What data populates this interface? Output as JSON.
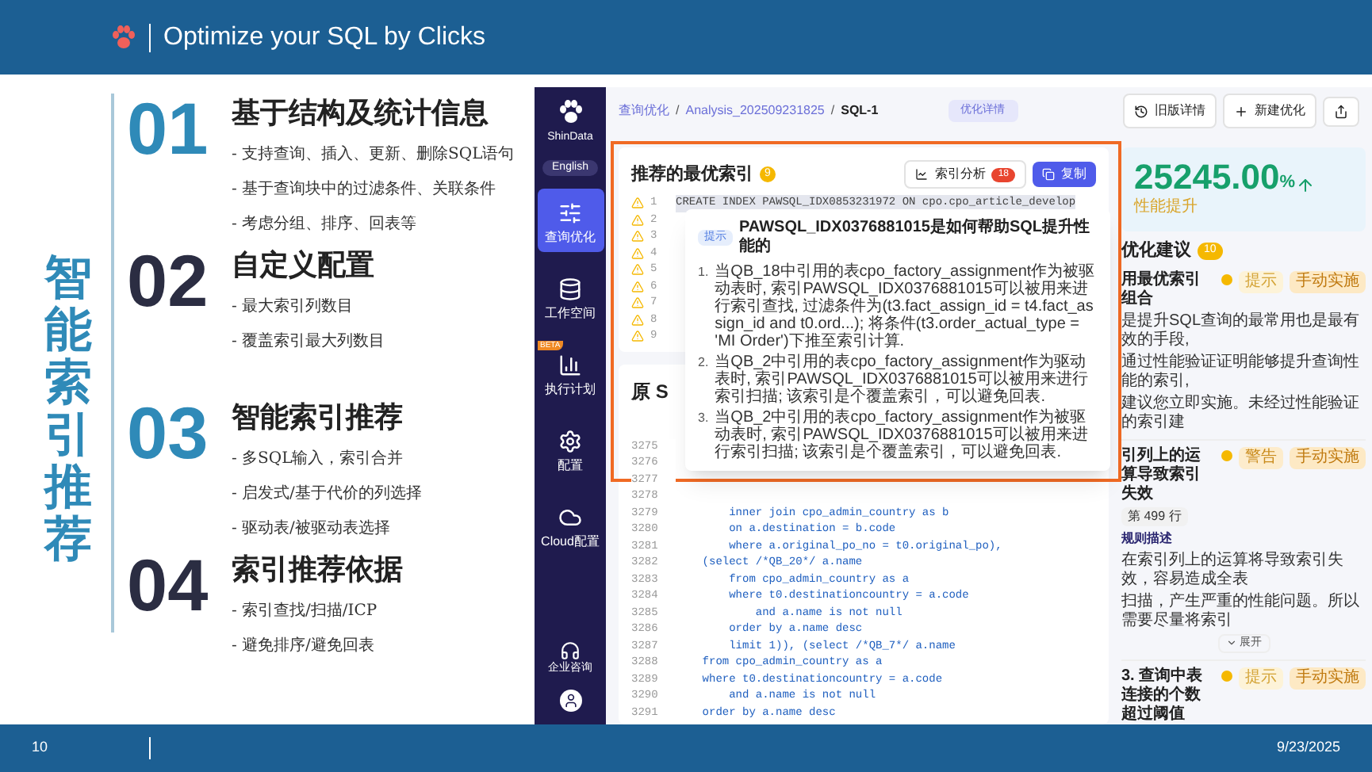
{
  "header": {
    "title": "Optimize your SQL by Clicks"
  },
  "side_title": "智能索引推荐",
  "sections": [
    {
      "number": "01",
      "color": "#2f8ab8",
      "heading": "基于结构及统计信息",
      "bullets": [
        "- 支持查询、插入、更新、删除SQL语句",
        "- 基于查询块中的过滤条件、关联条件",
        "- 考虑分组、排序、回表等"
      ]
    },
    {
      "number": "02",
      "color": "#2b2d42",
      "heading": "自定义配置",
      "bullets": [
        "- 最大索引列数目",
        "- 覆盖索引最大列数目"
      ]
    },
    {
      "number": "03",
      "color": "#2f8ab8",
      "heading": "智能索引推荐",
      "bullets": [
        "- 多SQL输入，索引合并",
        "- 启发式/基于代价的列选择",
        "- 驱动表/被驱动表选择"
      ]
    },
    {
      "number": "04",
      "color": "#2b2d42",
      "heading": "索引推荐依据",
      "bullets": [
        "- 索引查找/扫描/ICP",
        "- 避免排序/避免回表"
      ]
    }
  ],
  "app": {
    "sidebar": {
      "brand": "ShinData",
      "language": "English",
      "items": [
        {
          "kind": "tune",
          "label": "查询优化",
          "selected": true
        },
        {
          "kind": "database",
          "label": "工作空间",
          "selected": false
        },
        {
          "kind": "chart",
          "label": "执行计划",
          "selected": false,
          "badge": "BETA"
        },
        {
          "kind": "gear",
          "label": "配置",
          "selected": false
        },
        {
          "kind": "cloud",
          "label": "Cloud配置",
          "selected": false
        }
      ],
      "support": "企业咨询"
    },
    "breadcrumb": {
      "separator": "/",
      "items": [
        "查询优化",
        "Analysis_202509231825",
        "SQL-1"
      ]
    },
    "detail_tab": "优化详情",
    "actions": [
      {
        "kind": "history",
        "label": "旧版详情"
      },
      {
        "kind": "plus",
        "label": "新建优化"
      },
      {
        "kind": "share"
      }
    ],
    "index_card": {
      "title": "推荐的最优索引",
      "count": "9",
      "buttons": [
        {
          "kind": "analysis",
          "label": "索引分析",
          "badge": "18"
        },
        {
          "kind": "copy",
          "label": "复制"
        }
      ],
      "lines": [
        {
          "number": "1",
          "code": "CREATE INDEX PAWSQL_IDX0853231972 ON cpo.cpo_article_develop"
        },
        {
          "number": "2"
        },
        {
          "number": "3"
        },
        {
          "number": "4"
        },
        {
          "number": "5"
        },
        {
          "number": "6"
        },
        {
          "number": "7"
        },
        {
          "number": "8"
        },
        {
          "number": "9"
        }
      ]
    },
    "tooltip": {
      "tag": "提示",
      "title": "PAWSQL_IDX0376881015是如何帮助SQL提升性能的",
      "items": [
        {
          "number": "1.",
          "text": "当QB_18中引用的表cpo_factory_assignment作为被驱动表时, 索引PAWSQL_IDX0376881015可以被用来进行索引查找, 过滤条件为(t3.fact_assign_id = t4.fact_assign_id and t0.ord...); 将条件(t3.order_actual_type = 'MI Order')下推至索引计算."
        },
        {
          "number": "2.",
          "text": "当QB_2中引用的表cpo_factory_assignment作为驱动表时, 索引PAWSQL_IDX0376881015可以被用来进行索引扫描; 该索引是个覆盖索引，可以避免回表."
        },
        {
          "number": "3.",
          "text": "当QB_2中引用的表cpo_factory_assignment作为被驱动表时, 索引PAWSQL_IDX0376881015可以被用来进行索引扫描; 该索引是个覆盖索引，可以避免回表."
        }
      ]
    },
    "sql_card": {
      "title": "原 S",
      "lines": [
        {
          "number": "3275"
        },
        {
          "number": "3276"
        },
        {
          "number": "3277"
        },
        {
          "number": "3278"
        },
        {
          "number": "3279",
          "code": "        inner join cpo_admin_country as b"
        },
        {
          "number": "3280",
          "code": "        on a.destination = b.code"
        },
        {
          "number": "3281",
          "code": "        where a.original_po_no = t0.original_po),"
        },
        {
          "number": "3282",
          "code": "    (select /*QB_20*/ a.name"
        },
        {
          "number": "3283",
          "code": "        from cpo_admin_country as a"
        },
        {
          "number": "3284",
          "code": "        where t0.destinationcountry = a.code"
        },
        {
          "number": "3285",
          "code": "            and a.name is not null"
        },
        {
          "number": "3286",
          "code": "        order by a.name desc"
        },
        {
          "number": "3287",
          "code": "        limit 1)), (select /*QB_7*/ a.name"
        },
        {
          "number": "3288",
          "code": "    from cpo_admin_country as a"
        },
        {
          "number": "3289",
          "code": "    where t0.destinationcountry = a.code"
        },
        {
          "number": "3290",
          "code": "        and a.name is not null"
        },
        {
          "number": "3291",
          "code": "    order by a.name desc"
        }
      ]
    },
    "summary": {
      "value": "25245.00",
      "unit": "%",
      "label": "性能提升"
    },
    "suggestions": {
      "title": "优化建议",
      "count": "10",
      "items": [
        {
          "heading": "用最优索引组合",
          "level": "提示",
          "action": "手动实施",
          "lines": [
            "是提升SQL查询的最常用也是最有效的手段,",
            "通过性能验证证明能够提升查询性能的索引,",
            "建议您立即实施。未经过性能验证的索引建"
          ]
        },
        {
          "heading": "引列上的运算导致索引失效",
          "level": "警告",
          "action": "手动实施",
          "location": "第 499 行",
          "rule_title": "规则描述",
          "lines": [
            "在索引列上的运算将导致索引失效，容易造成全表",
            "扫描，产生严重的性能问题。所以需要尽量将索引"
          ],
          "expand": "展开"
        },
        {
          "heading": "3. 查询中表连接的个数超过阈值",
          "level": "提示",
          "action": "手动实施"
        }
      ]
    }
  },
  "footer": {
    "page": "10",
    "date": "9/23/2025"
  }
}
